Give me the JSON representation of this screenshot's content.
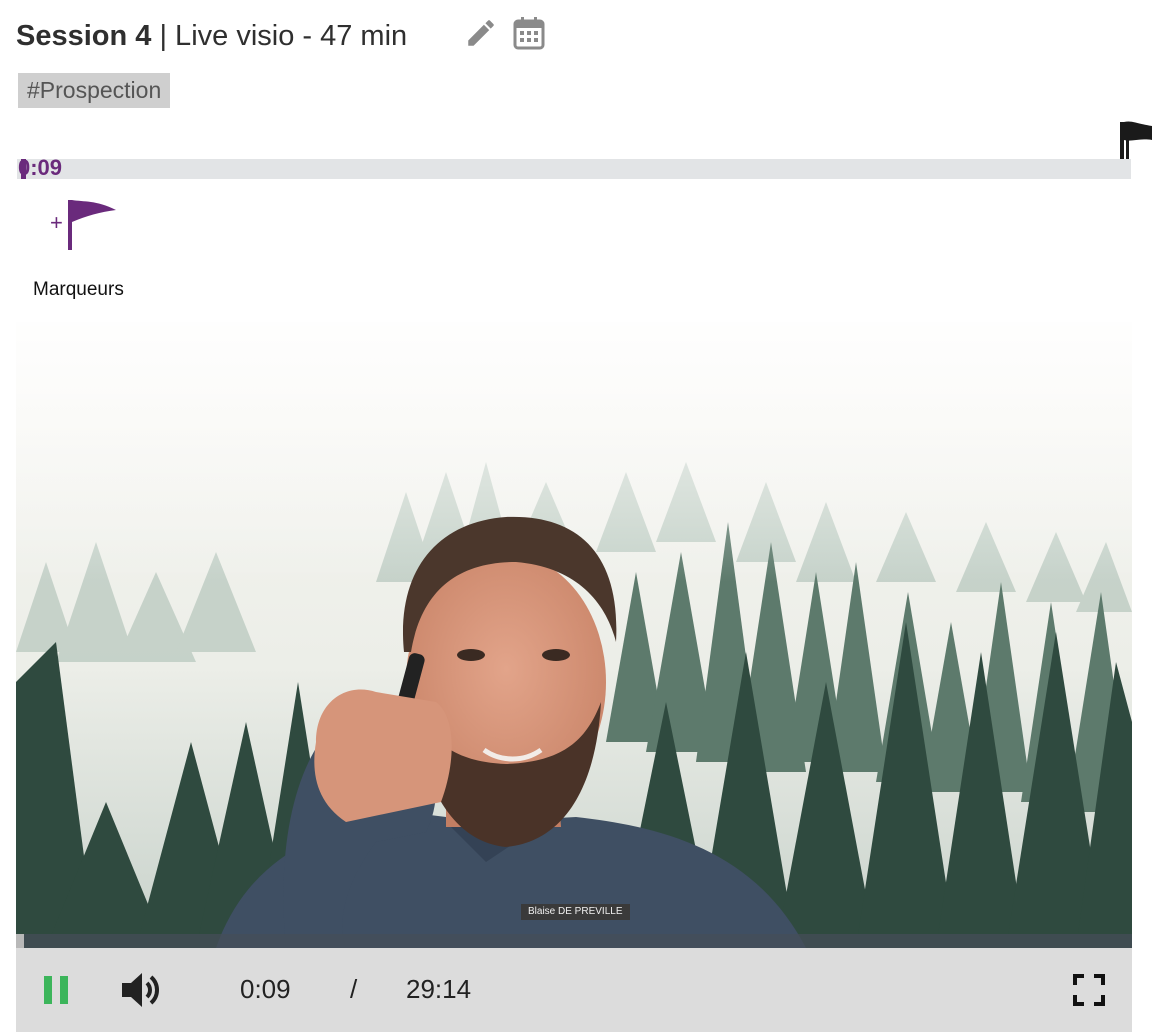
{
  "header": {
    "session_label": "Session 4",
    "session_detail": "| Live visio - 47 min",
    "edit_icon": "pencil-icon",
    "calendar_icon": "calendar-icon"
  },
  "tag": "#Prospection",
  "timeline": {
    "current_time": "0:09",
    "progress_fraction": 0.005,
    "end_flag_icon": "flag-icon"
  },
  "markers": {
    "add_icon": "add-flag-icon",
    "label": "Marqueurs"
  },
  "video": {
    "speaker_name": "Blaise DE PREVILLE",
    "progress_fraction": 0.005
  },
  "controls": {
    "play_state_icon": "pause-icon",
    "volume_icon": "volume-icon",
    "current_time": "0:09",
    "separator": "/",
    "duration": "29:14",
    "fullscreen_icon": "fullscreen-icon"
  },
  "colors": {
    "accent": "#6a2a7c",
    "pause": "#3cb55b",
    "icon_gray": "#8a8a8a"
  }
}
